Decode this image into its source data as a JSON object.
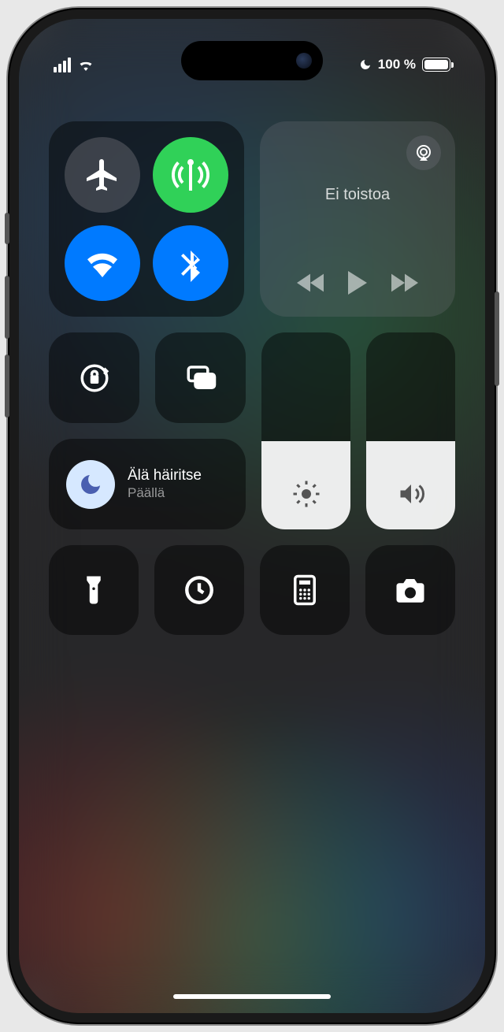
{
  "status": {
    "battery_text": "100 %"
  },
  "media": {
    "title": "Ei toistoa"
  },
  "focus": {
    "title": "Älä häiritse",
    "subtitle": "Päällä"
  },
  "sliders": {
    "brightness_level": 0.45,
    "volume_level": 0.45
  }
}
